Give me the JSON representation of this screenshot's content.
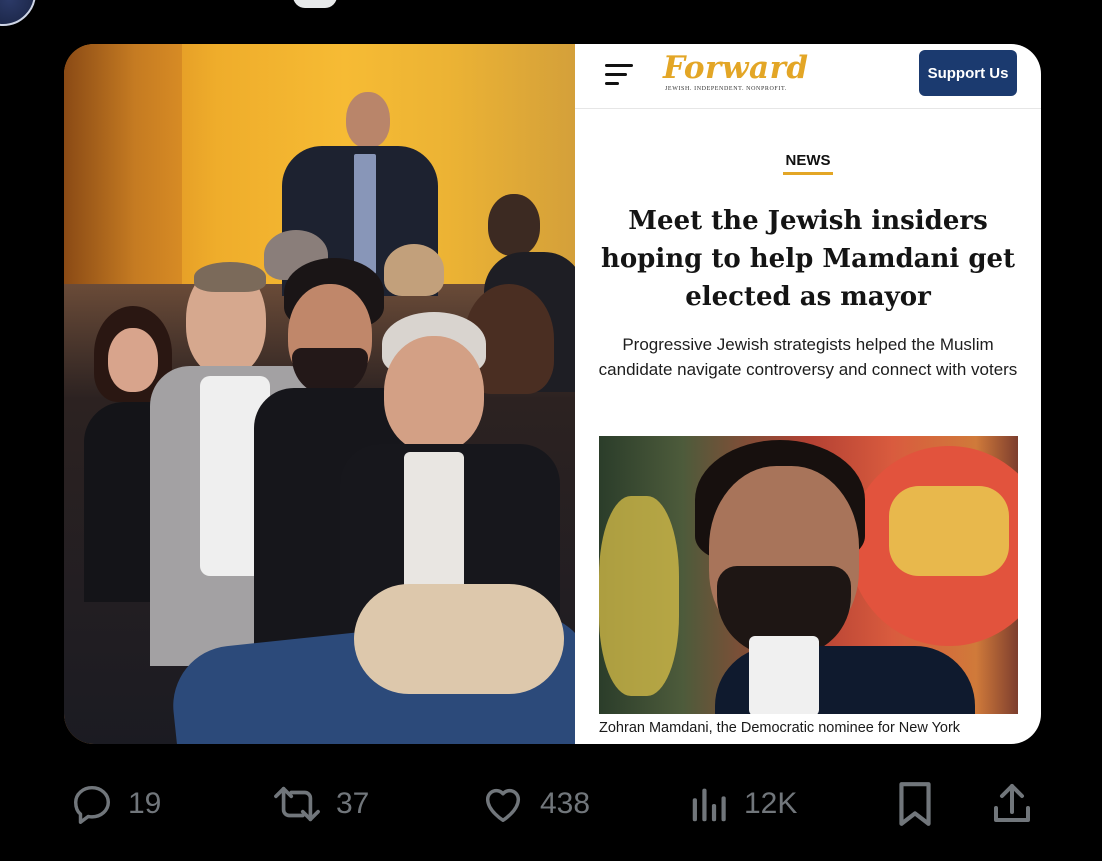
{
  "post_media": {
    "photo": {
      "type": "photo"
    },
    "article_screenshot": {
      "header": {
        "logo_text": "Forward",
        "logo_tagline": "JEWISH. INDEPENDENT. NONPROFIT.",
        "support_button": "Support Us",
        "menu_icon": "hamburger-icon"
      },
      "kicker": "NEWS",
      "headline": "Meet the Jewish insiders hoping to help Mamdani get elected as mayor",
      "dek": "Progressive Jewish strategists helped the Muslim candidate navigate controversy and connect with voters",
      "hero_caption": "Zohran Mamdani, the Democratic nominee for New York"
    }
  },
  "actions": {
    "reply": {
      "icon": "reply-icon",
      "count": "19"
    },
    "repost": {
      "icon": "repost-icon",
      "count": "37"
    },
    "like": {
      "icon": "heart-icon",
      "count": "438"
    },
    "views": {
      "icon": "views-icon",
      "count": "12K"
    },
    "bookmark": {
      "icon": "bookmark-icon"
    },
    "share": {
      "icon": "share-icon"
    }
  },
  "colors": {
    "background": "#000000",
    "action_gray": "#71767b",
    "forward_gold": "#e3a626",
    "support_blue": "#1b3a6f"
  }
}
